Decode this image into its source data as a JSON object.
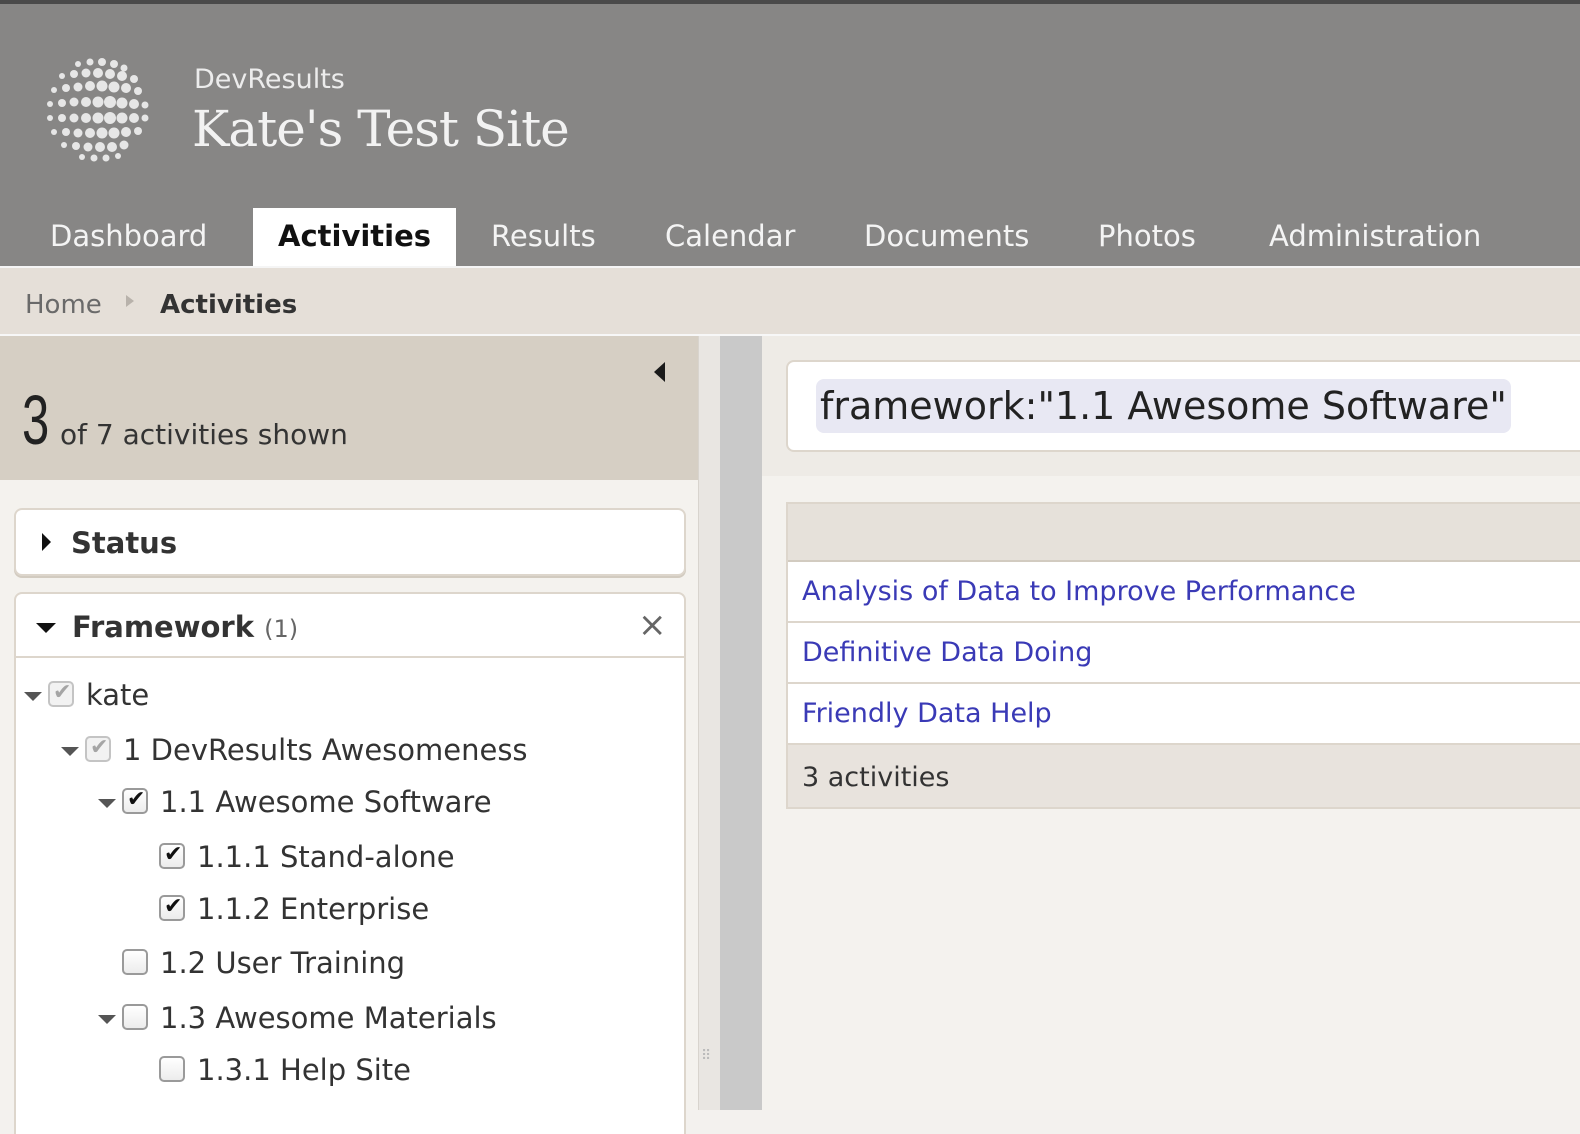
{
  "brand": {
    "name": "DevResults",
    "site_title": "Kate's Test Site"
  },
  "nav": {
    "tabs": [
      {
        "label": "Dashboard",
        "active": false
      },
      {
        "label": "Activities",
        "active": true
      },
      {
        "label": "Results",
        "active": false
      },
      {
        "label": "Calendar",
        "active": false
      },
      {
        "label": "Documents",
        "active": false
      },
      {
        "label": "Photos",
        "active": false
      },
      {
        "label": "Administration",
        "active": false
      }
    ]
  },
  "breadcrumb": {
    "home": "Home",
    "current": "Activities"
  },
  "summary": {
    "shown": "3",
    "text": "of 7 activities shown"
  },
  "facets": {
    "status": {
      "title": "Status",
      "expanded": false
    },
    "framework": {
      "title": "Framework",
      "count": "(1)",
      "expanded": true,
      "tree": [
        {
          "label": "kate",
          "state": "partial",
          "expanded": true
        },
        {
          "label": "1 DevResults Awesomeness",
          "state": "partial",
          "expanded": true
        },
        {
          "label": "1.1 Awesome Software",
          "state": "checked",
          "expanded": true
        },
        {
          "label": "1.1.1 Stand-alone",
          "state": "checked"
        },
        {
          "label": "1.1.2 Enterprise",
          "state": "checked"
        },
        {
          "label": "1.2 User Training",
          "state": "unchecked"
        },
        {
          "label": "1.3 Awesome Materials",
          "state": "unchecked",
          "expanded": true
        },
        {
          "label": "1.3.1 Help Site",
          "state": "unchecked"
        }
      ]
    }
  },
  "search": {
    "token": "framework:\"1.1 Awesome Software\""
  },
  "results": {
    "rows": [
      "Analysis of Data to Improve Performance",
      "Definitive Data Doing",
      "Friendly Data Help"
    ],
    "footer": "3 activities"
  },
  "colors": {
    "header_bg": "#878685",
    "link": "#3a3ab6",
    "summary_bg": "#d6cfc4"
  }
}
